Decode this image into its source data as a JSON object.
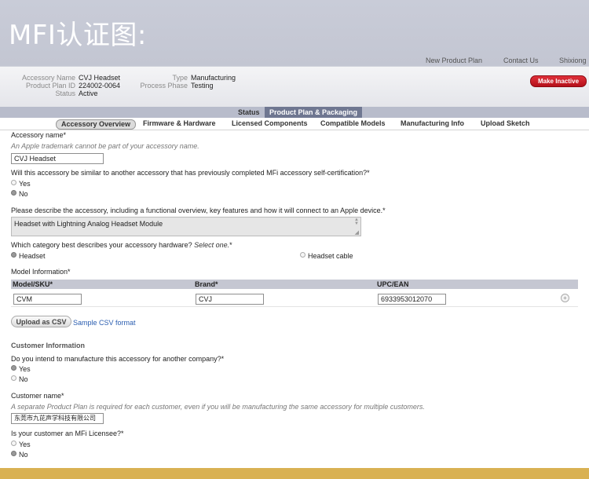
{
  "banner": {
    "title": "MFI认证图:"
  },
  "topnav": {
    "items": [
      "New Product Plan",
      "Contact Us",
      "Shixiong"
    ]
  },
  "header": {
    "accessory_name_label": "Accessory Name",
    "accessory_name": "CVJ Headset",
    "product_plan_id_label": "Product Plan ID",
    "product_plan_id": "224002-0064",
    "status_label": "Status",
    "status": "Active",
    "type_label": "Type",
    "type": "Manufacturing",
    "process_phase_label": "Process Phase",
    "process_phase": "Testing",
    "make_inactive": "Make Inactive"
  },
  "tabs": {
    "status": "Status",
    "product_plan": "Product Plan & Packaging"
  },
  "subnav": [
    "Accessory Overview",
    "Firmware & Hardware",
    "Licensed Components",
    "Compatible Models",
    "Manufacturing Info",
    "Upload Sketch"
  ],
  "form": {
    "accessory_name_label": "Accessory name*",
    "accessory_name_hint": "An Apple trademark cannot be part of your accessory name.",
    "accessory_name_value": "CVJ Headset",
    "similar_question": "Will this accessory be similar to another accessory that has previously completed MFi accessory self-certification?*",
    "yes": "Yes",
    "no": "No",
    "describe_label": "Please describe the accessory, including a functional overview, key features and how it will connect to an Apple device.*",
    "describe_value": "Headset with Lightning Analog Headset Module",
    "category_label": "Which category best describes your accessory hardware?",
    "category_select": "Select one.",
    "category_star": "*",
    "category_headset": "Headset",
    "category_cable": "Headset cable",
    "model_info_label": "Model Information*",
    "col_model": "Model/SKU*",
    "col_brand": "Brand*",
    "col_upc": "UPC/EAN",
    "model_value": "CVM",
    "brand_value": "CVJ",
    "upc_value": "6933953012070",
    "upload_csv": "Upload as CSV",
    "sample_csv": "Sample CSV format",
    "customer_info_title": "Customer Information",
    "manufacture_question": "Do you intend to manufacture this accessory for another company?*",
    "customer_name_label": "Customer name*",
    "customer_name_hint": "A separate Product Plan is required for each customer, even if you will be manufacturing the same accessory for multiple customers.",
    "customer_name_value": "东莞市九芘声学科技有限公司",
    "licensee_question": "Is your customer an MFi Licensee?*"
  }
}
